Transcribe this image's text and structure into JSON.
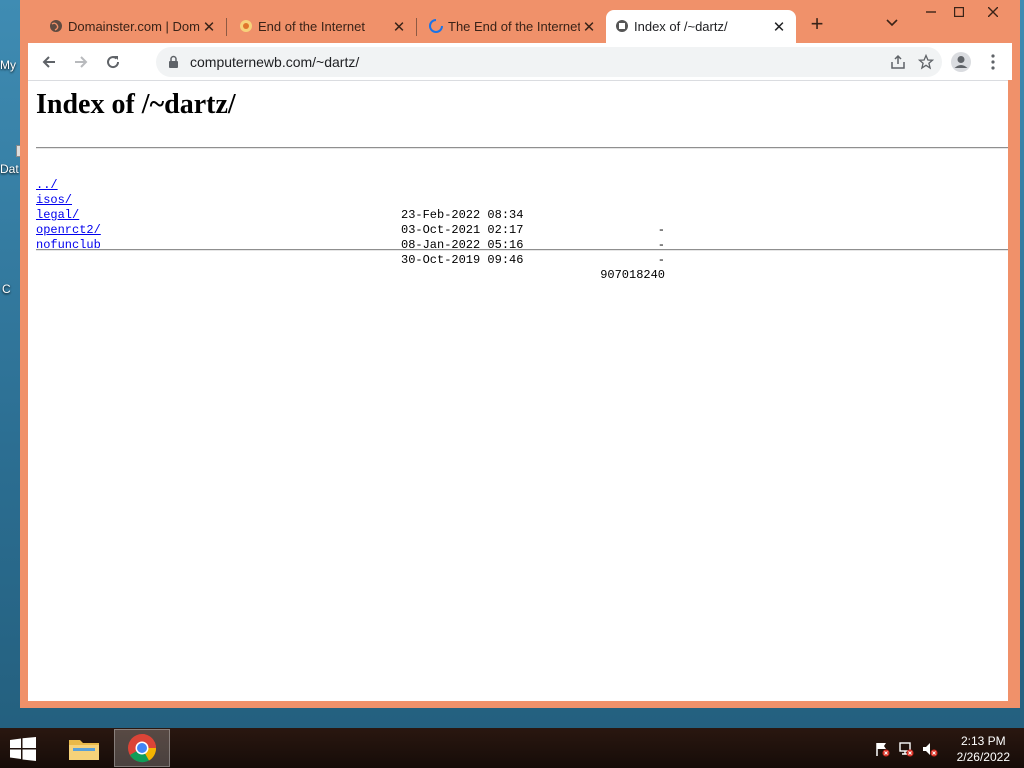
{
  "desktop": {
    "labels": [
      "My",
      "Dat",
      "C"
    ]
  },
  "browser": {
    "tabs": [
      {
        "title": "Domainster.com | Domai",
        "favicon": "globe-icon"
      },
      {
        "title": "End of the Internet",
        "favicon": "site-icon"
      },
      {
        "title": "The End of the Internet",
        "favicon": "loading-spinner-icon"
      },
      {
        "title": "Index of /~dartz/",
        "favicon": "page-icon",
        "active": true
      }
    ],
    "url": "computernewb.com/~dartz/",
    "accent": "#f0916a"
  },
  "page": {
    "title": "Index of /~dartz/",
    "parent_link": "../",
    "entries": [
      {
        "name": "isos/",
        "date": "23-Feb-2022 08:34",
        "size": "-"
      },
      {
        "name": "legal/",
        "date": "03-Oct-2021 02:17",
        "size": "-"
      },
      {
        "name": "openrct2/",
        "date": "08-Jan-2022 05:16",
        "size": "-"
      },
      {
        "name": "nofunclub",
        "date": "30-Oct-2019 09:46",
        "size": "907018240"
      }
    ],
    "link_color": "#0000ee"
  },
  "taskbar": {
    "time": "2:13 PM",
    "date": "2/26/2022",
    "apps": [
      "file-explorer-icon",
      "chrome-icon"
    ]
  }
}
